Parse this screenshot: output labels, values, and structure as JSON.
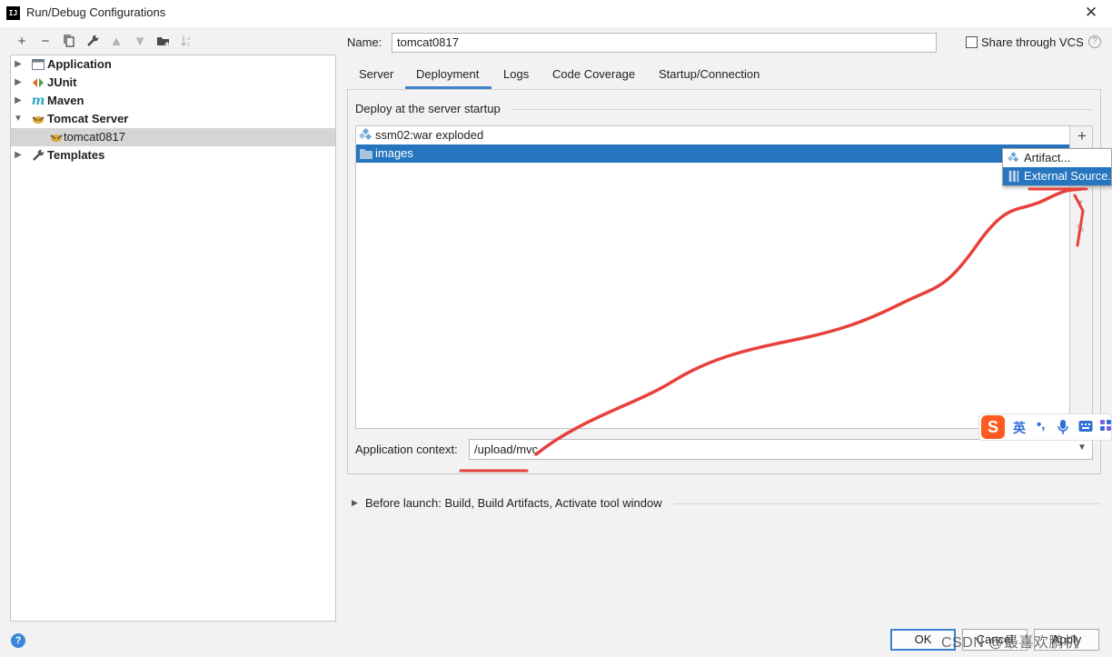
{
  "window": {
    "title": "Run/Debug Configurations",
    "logo_text": "IJ"
  },
  "tree": {
    "items": [
      {
        "label": "Application"
      },
      {
        "label": "JUnit"
      },
      {
        "label": "Maven"
      },
      {
        "label": "Tomcat Server"
      },
      {
        "label": "tomcat0817"
      },
      {
        "label": "Templates"
      }
    ]
  },
  "config": {
    "name_label": "Name:",
    "name_value": "tomcat0817",
    "share_label": "Share through VCS",
    "share_checked": false
  },
  "tabs": [
    {
      "label": "Server"
    },
    {
      "label": "Deployment",
      "selected": true
    },
    {
      "label": "Logs"
    },
    {
      "label": "Code Coverage"
    },
    {
      "label": "Startup/Connection"
    }
  ],
  "deployment": {
    "section_title": "Deploy at the server startup",
    "items": [
      {
        "label": "ssm02:war exploded",
        "icon": "artifact-icon"
      },
      {
        "label": "images",
        "icon": "folder-icon",
        "selected": true
      }
    ],
    "add_menu": [
      {
        "label": "Artifact...",
        "icon": "artifact-icon"
      },
      {
        "label": "External Source...",
        "icon": "external-source-icon",
        "selected": true
      }
    ],
    "context_label": "Application context:",
    "context_value": "/upload/mvc"
  },
  "before_launch": {
    "label": "Before launch: Build, Build Artifacts, Activate tool window"
  },
  "buttons": {
    "ok": "OK",
    "cancel": "Cancel",
    "apply": "Apply"
  },
  "ime": {
    "logo": "S",
    "lang": "英",
    "punct": "•,"
  },
  "watermark": "CSDN @最喜欢鹏机",
  "colors": {
    "selection": "#2675bf",
    "tab_underline": "#4083c9",
    "annotation": "#e8403a"
  }
}
